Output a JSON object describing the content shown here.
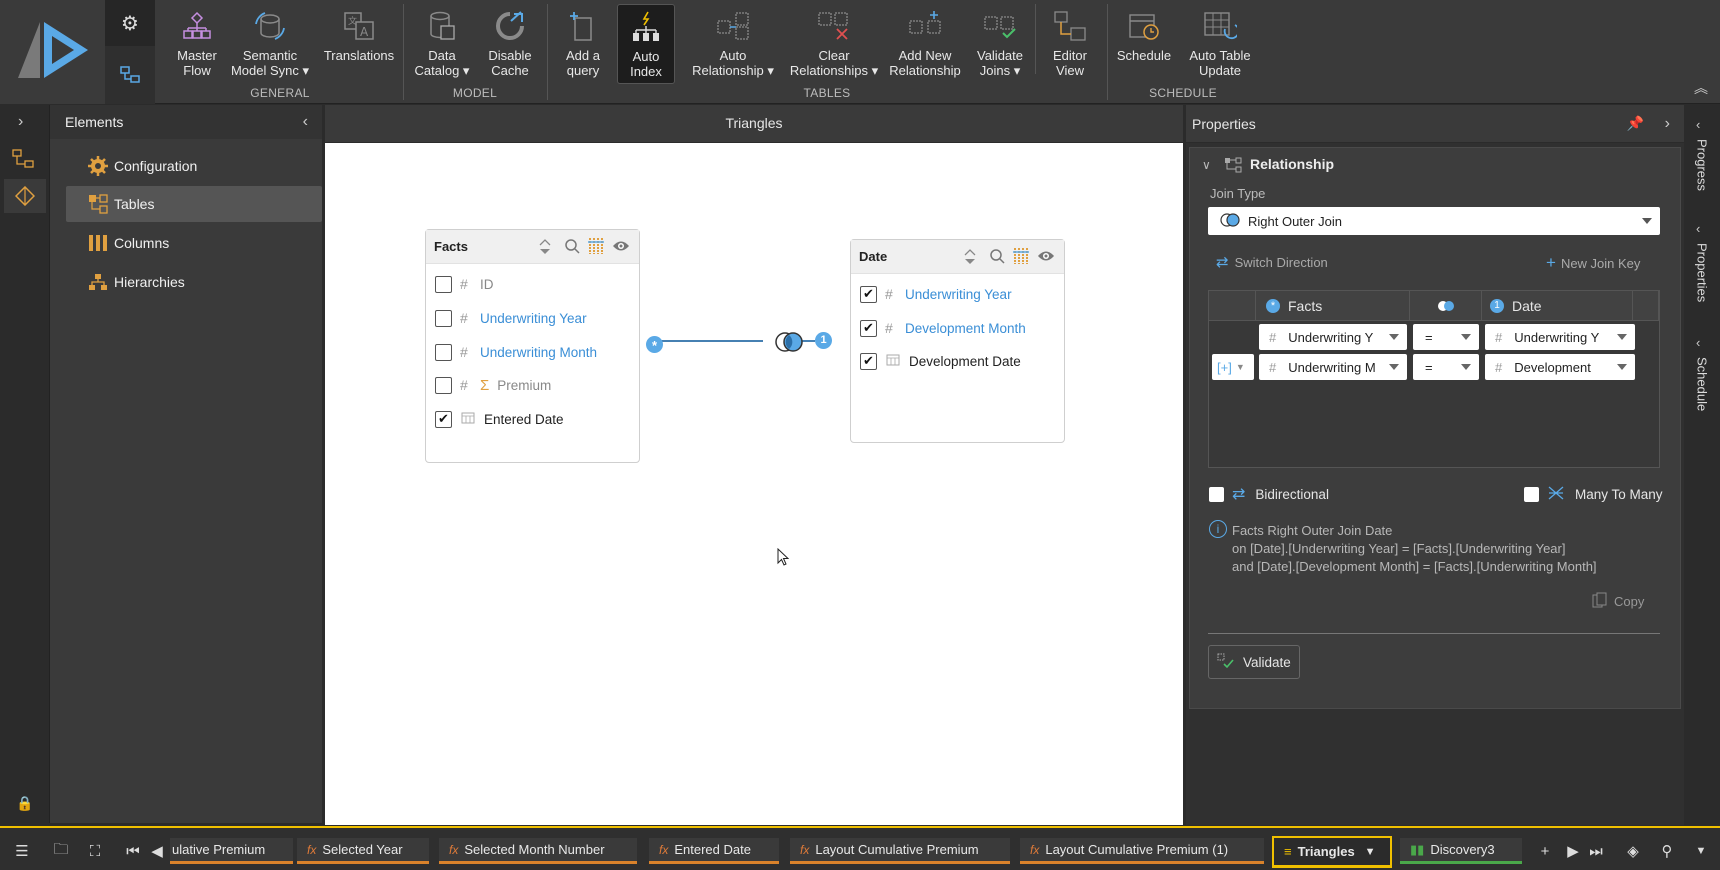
{
  "ribbon": {
    "groups": [
      {
        "label": "GENERAL"
      },
      {
        "label": "MODEL"
      },
      {
        "label": "TABLES"
      },
      {
        "label": "SCHEDULE"
      }
    ],
    "buttons": {
      "master_flow": [
        "Master",
        "Flow"
      ],
      "semantic_sync": [
        "Semantic",
        "Model Sync ▾"
      ],
      "translations": [
        "Translations"
      ],
      "data_catalog": [
        "Data",
        "Catalog ▾"
      ],
      "disable_cache": [
        "Disable",
        "Cache"
      ],
      "add_query": [
        "Add a",
        "query"
      ],
      "auto_index": [
        "Auto",
        "Index"
      ],
      "auto_relationship": [
        "Auto",
        "Relationship ▾"
      ],
      "clear_relationships": [
        "Clear",
        "Relationships ▾"
      ],
      "add_new_relationship": [
        "Add New",
        "Relationship"
      ],
      "validate_joins": [
        "Validate",
        "Joins ▾"
      ],
      "editor_view": [
        "Editor",
        "View"
      ],
      "schedule": [
        "Schedule"
      ],
      "auto_table_update": [
        "Auto Table",
        "Update"
      ]
    }
  },
  "elements": {
    "title": "Elements",
    "items": [
      {
        "label": "Configuration"
      },
      {
        "label": "Tables"
      },
      {
        "label": "Columns"
      },
      {
        "label": "Hierarchies"
      }
    ]
  },
  "canvas": {
    "title": "Triangles",
    "facts": {
      "name": "Facts",
      "rows": [
        {
          "label": "ID",
          "checked": false,
          "type": "#"
        },
        {
          "label": "Underwriting Year",
          "checked": false,
          "type": "#"
        },
        {
          "label": "Underwriting Month",
          "checked": false,
          "type": "#"
        },
        {
          "label": "Premium",
          "checked": false,
          "type": "Σ"
        },
        {
          "label": "Entered Date",
          "checked": true,
          "type": "date"
        }
      ]
    },
    "date": {
      "name": "Date",
      "rows": [
        {
          "label": "Underwriting Year",
          "checked": true,
          "type": "#"
        },
        {
          "label": "Development Month",
          "checked": true,
          "type": "#"
        },
        {
          "label": "Development Date",
          "checked": true,
          "type": "date"
        }
      ]
    },
    "join_left_badge": "*",
    "join_right_badge": "1"
  },
  "properties": {
    "title": "Properties",
    "section": "Relationship",
    "join_type_label": "Join Type",
    "join_type_value": "Right Outer Join",
    "switch_direction": "Switch Direction",
    "new_join_key": "New Join Key",
    "grid": {
      "left_header": "Facts",
      "right_header": "Date",
      "add_label": "[+]",
      "rows": [
        {
          "left": "Underwriting Y",
          "op": "=",
          "right": "Underwriting Y"
        },
        {
          "left": "Underwriting M",
          "op": "=",
          "right": "Development"
        }
      ]
    },
    "bidirectional": "Bidirectional",
    "many_to_many": "Many To Many",
    "summary": [
      "Facts Right Outer Join Date",
      "on [Date].[Underwriting Year] = [Facts].[Underwriting Year]",
      "and [Date].[Development Month] = [Facts].[Underwriting Month]"
    ],
    "copy": "Copy",
    "validate": "Validate"
  },
  "right_tabs": [
    "Progress",
    "Properties",
    "Schedule"
  ],
  "bottom_tabs": [
    {
      "label": "ulative Premium"
    },
    {
      "label": "Selected Year"
    },
    {
      "label": "Selected Month Number"
    },
    {
      "label": "Entered Date"
    },
    {
      "label": "Layout Cumulative Premium"
    },
    {
      "label": "Layout Cumulative Premium (1)"
    }
  ],
  "active_tab": "Triangles",
  "discovery_tab": "Discovery3"
}
